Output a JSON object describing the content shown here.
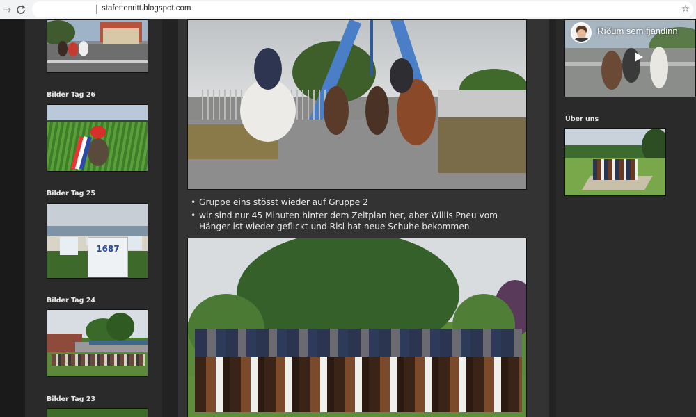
{
  "browser": {
    "back_icon": "back-arrow-icon",
    "reload_icon": "reload-icon",
    "url": "stafettenritt.blogspot.com",
    "bookmark_icon": "star-icon"
  },
  "sidebar_left": {
    "sections": [
      {
        "label": "Bilder Tag 26"
      },
      {
        "label": "Bilder Tag 25"
      },
      {
        "label": "Bilder Tag 24"
      },
      {
        "label": "Bilder Tag 23"
      }
    ]
  },
  "main": {
    "bullets": [
      "Gruppe eins stösst wieder auf Gruppe 2",
      "wir sind nur 45 Minuten hinter dem Zeitplan her, aber Willis Pneu vom Hänger ist wieder geflickt und Risi hat neue Schuhe bekommen"
    ]
  },
  "sidebar_right": {
    "video_title": "Ríðum sem fjandinn",
    "about_label": "Über uns"
  }
}
